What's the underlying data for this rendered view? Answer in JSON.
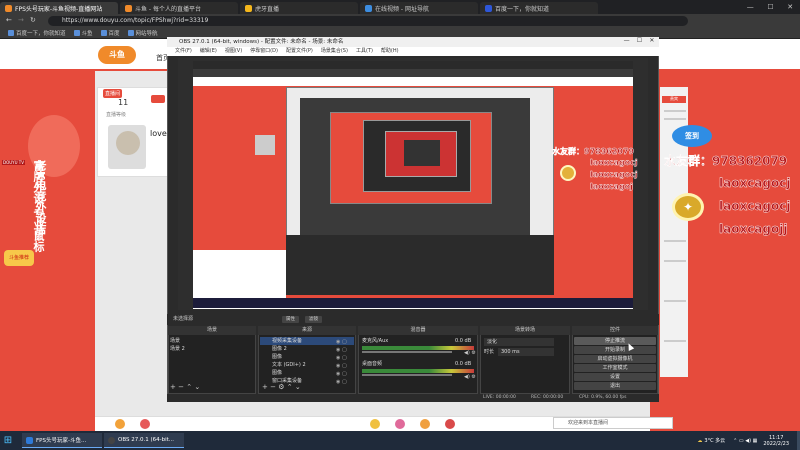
{
  "browser": {
    "tabs": [
      {
        "label": "FPS头号玩家-斗鱼视频-直播网站",
        "active": true
      },
      {
        "label": "斗鱼 - 每个人的直播平台",
        "active": false
      },
      {
        "label": "虎牙直播",
        "active": false
      },
      {
        "label": "在线视频 - 网址导航",
        "active": false
      },
      {
        "label": "百度一下，你就知道",
        "active": false
      }
    ],
    "url": "https://www.douyu.com/topic/FPShwj?rid=33319",
    "bookmarks": [
      "百度一下，你就知道",
      "斗鱼",
      "百度",
      "网站导航"
    ]
  },
  "douyu": {
    "logo": "斗鱼",
    "nav_first": "首页",
    "level_badge": "直播间",
    "level_number": "11",
    "level_sub": "直播等级",
    "anchor_name": "lovey",
    "left_vertical_a": "老K电竞外设店",
    "left_vertical_b": "富牌外设 专业鼠标",
    "left_tag": "DOUYU TV",
    "fish_logo": "斗鱼推荐",
    "sign_badge": "签到",
    "right_head": "贵宾",
    "chat_placeholder": "欢迎来到本直播间"
  },
  "overlay_chat": {
    "small_lines": [
      "水友群：978362079",
      "laoxcagocj",
      "laoxcagocj",
      "laoxcagoj"
    ],
    "large_lines": [
      "水友群：978362079",
      "laoxcagocj",
      "laoxcagocj",
      "laoxcagojj"
    ]
  },
  "obs": {
    "title": "OBS 27.0.1 (64-bit, windows) - 配置文件: 未命名 - 场景: 未命名",
    "menu": [
      "文件(F)",
      "编辑(E)",
      "视图(V)",
      "停靠窗口(D)",
      "配置文件(P)",
      "场景集合(S)",
      "工具(T)",
      "帮助(H)"
    ],
    "window_controls": [
      "—",
      "☐",
      "✕"
    ],
    "scene_selector": "未选择源",
    "props_button": "属性",
    "filters_button": "滤镜",
    "docks": {
      "scenes": {
        "header": "场景",
        "items": [
          "场景",
          "场景 2"
        ]
      },
      "sources": {
        "header": "来源",
        "items": [
          "视频采集设备",
          "图像 2",
          "图像",
          "文本 (GDI+) 2",
          "图像",
          "窗口采集设备"
        ]
      },
      "mixer": {
        "header": "混音器",
        "tracks": [
          {
            "name": "麦克风/Aux",
            "db": "0.0 dB"
          },
          {
            "name": "桌面音频",
            "db": "0.0 dB"
          }
        ]
      },
      "transitions": {
        "header": "场景转场",
        "type": "淡化",
        "duration_label": "时长",
        "duration_value": "300 ms"
      },
      "controls": {
        "header": "控件",
        "buttons": [
          "停止推流",
          "开始录制",
          "启动虚拟摄像机",
          "工作室模式",
          "设置",
          "退出"
        ]
      }
    },
    "status": {
      "live": "LIVE: 00:00:00",
      "rec": "REC: 00:00:00",
      "cpu": "CPU: 0.9%, 60.00 fps"
    }
  },
  "taskbar": {
    "start_icon": "windows-logo",
    "apps": [
      "FPS头号玩家-斗鱼...",
      "OBS 27.0.1 (64-bit..."
    ],
    "weather": "3°C 多云",
    "time": "11:17",
    "date": "2022/2/23"
  },
  "colors": {
    "douyu_red": "#e64b3c",
    "obs_bg": "#2b2b2b",
    "overlay_text": "#b4151a",
    "taskbar": "#1f2a3a"
  }
}
